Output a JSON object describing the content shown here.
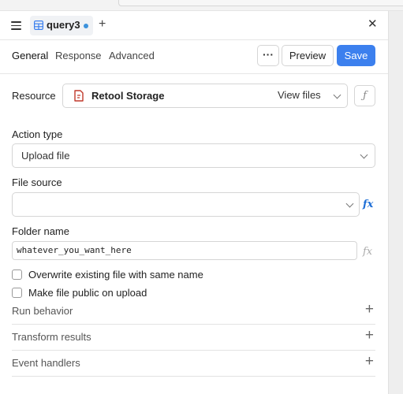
{
  "tab": {
    "query_name": "query3",
    "add_symbol": "+",
    "close_symbol": "✕"
  },
  "subtabs": {
    "general": "General",
    "response": "Response",
    "advanced": "Advanced",
    "more": "···",
    "preview": "Preview",
    "save": "Save"
  },
  "resource": {
    "label": "Resource",
    "value": "Retool Storage",
    "view_files": "View files",
    "fx_symbol": "ƒ"
  },
  "action_type": {
    "label": "Action type",
    "value": "Upload file"
  },
  "file_source": {
    "label": "File source",
    "value": "",
    "fx_symbol": "fx"
  },
  "folder_name": {
    "label": "Folder name",
    "value": "whatever_you_want_here",
    "fx_symbol": "fx"
  },
  "options": {
    "overwrite": "Overwrite existing file with same name",
    "make_public": "Make file public on upload"
  },
  "sections": {
    "run_behavior": "Run behavior",
    "transform_results": "Transform results",
    "event_handlers": "Event handlers",
    "plus_symbol": "+"
  },
  "colors": {
    "accent": "#3c80ee",
    "unsaved_dot": "#3c92dc",
    "fx_active": "#1f6fd6",
    "file_icon": "#c0392b"
  }
}
